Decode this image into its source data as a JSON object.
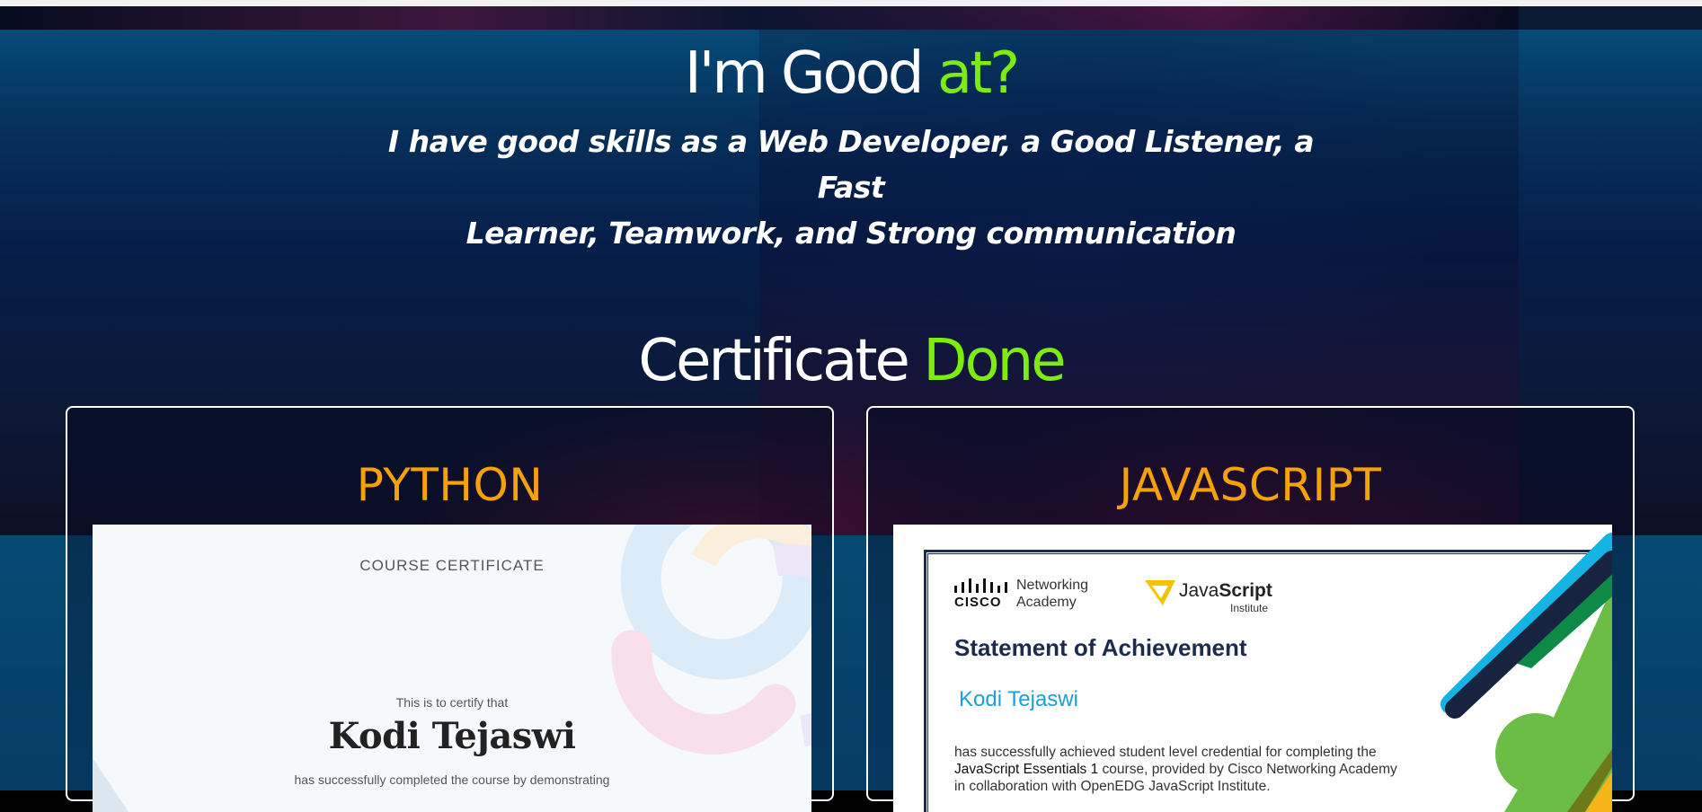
{
  "skills": {
    "heading_main": "I'm Good ",
    "heading_accent": "at?",
    "description_line1": "I have good skills as a Web Developer, a Good Listener, a Fast",
    "description_line2": "Learner, Teamwork, and Strong communication"
  },
  "certificates_section": {
    "heading_main": "Certificate ",
    "heading_accent": "Done"
  },
  "certificates": [
    {
      "title": "PYTHON",
      "image": {
        "label": "COURSE CERTIFICATE",
        "certify_text": "This is to certify that",
        "name": "Kodi Tejaswi",
        "description": "has successfully completed the course by demonstrating"
      }
    },
    {
      "title": "JAVASCRIPT",
      "image": {
        "cisco_word": "CISCO",
        "networking": "Networking",
        "academy": "Academy",
        "js_prefix": "Java",
        "js_bold": "Script",
        "institute": "Institute",
        "heading": "Statement of Achievement",
        "name": "Kodi Tejaswi",
        "body_line1": "has successfully achieved student level credential for completing the",
        "body_course": "JavaScript Essentials 1",
        "body_line2_rest": " course, provided by Cisco Networking Academy",
        "body_line3": "in collaboration with OpenEDG JavaScript Institute."
      }
    }
  ],
  "colors": {
    "accent_green": "#7dec10",
    "card_title_orange": "#f5a10a",
    "name_blue": "#1aa0d8"
  }
}
